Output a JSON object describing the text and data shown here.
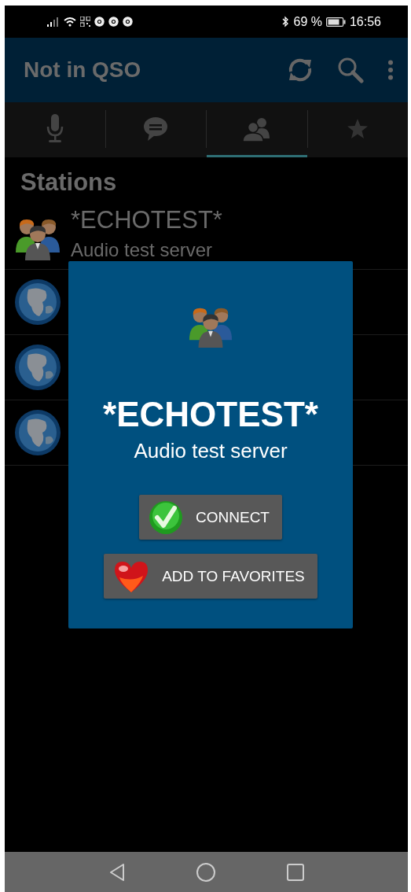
{
  "status_bar": {
    "battery": "69 %",
    "time": "16:56"
  },
  "app_bar": {
    "title": "Not in QSO"
  },
  "tabs": [
    {
      "selected": false
    },
    {
      "selected": false
    },
    {
      "selected": true
    },
    {
      "selected": false
    }
  ],
  "section_title": "Stations",
  "stations": [
    {
      "kind": "group",
      "name": "*ECHOTEST*",
      "subtitle": "Audio test server"
    },
    {
      "kind": "globe"
    },
    {
      "kind": "globe"
    },
    {
      "kind": "globe"
    }
  ],
  "dialog": {
    "title": "*ECHOTEST*",
    "subtitle": "Audio test server",
    "buttons": [
      {
        "kind": "connect",
        "label": "CONNECT"
      },
      {
        "kind": "favorite",
        "label": "ADD TO FAVORITES"
      }
    ]
  }
}
